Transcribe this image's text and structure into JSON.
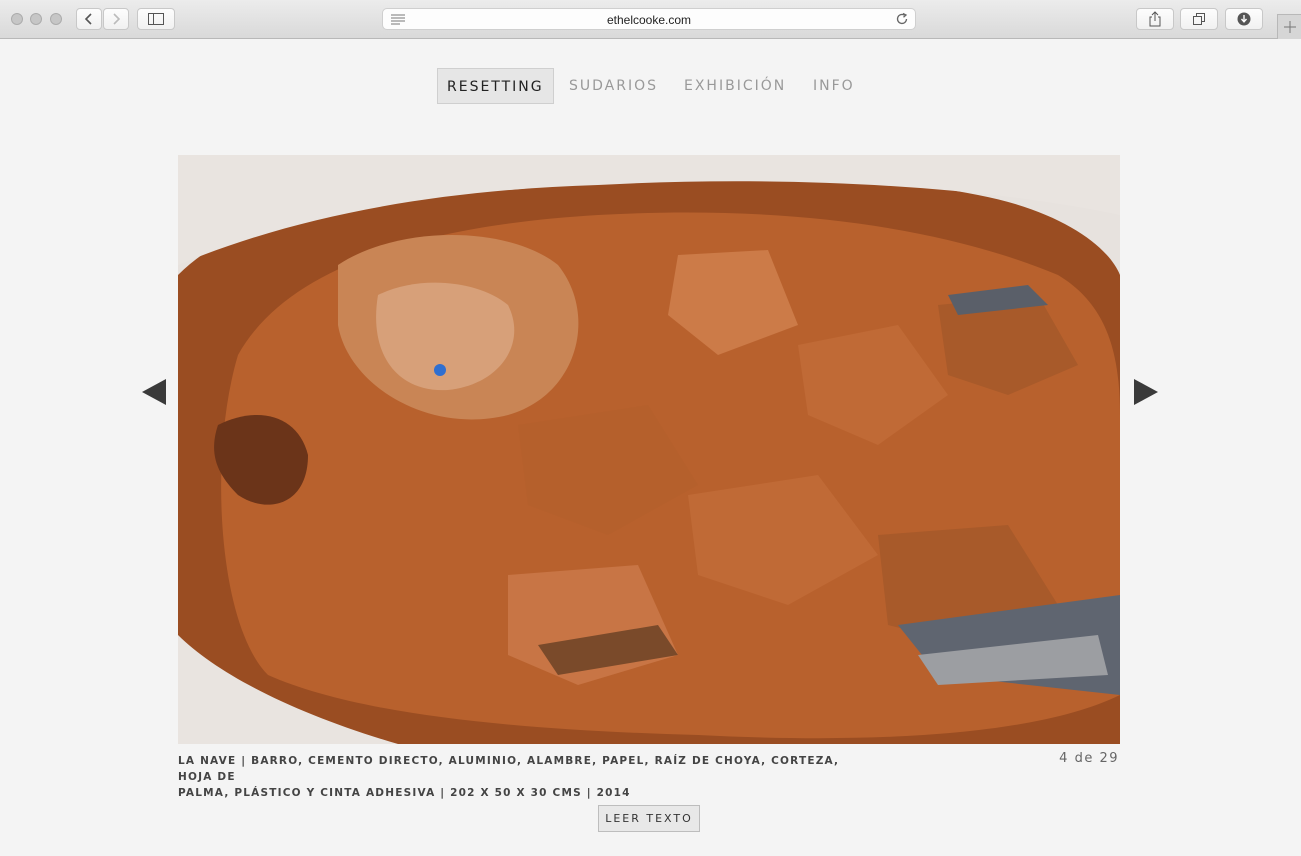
{
  "browser": {
    "url": "ethelcooke.com"
  },
  "nav": {
    "items": [
      {
        "label": "RESETTING",
        "active": true
      },
      {
        "label": "SUDARIOS",
        "active": false
      },
      {
        "label": "EXHIBICIÓN",
        "active": false
      },
      {
        "label": "INFO",
        "active": false
      }
    ]
  },
  "artwork": {
    "caption_line1": "LA NAVE | BARRO, CEMENTO DIRECTO, ALUMINIO, ALAMBRE, PAPEL, RAÍZ DE CHOYA, CORTEZA, HOJA DE",
    "caption_line2": "PALMA, PLÁSTICO Y CINTA ADHESIVA | 202 X 50 X 30 CMS | 2014",
    "counter": "4 de 29",
    "read_button": "LEER TEXTO"
  },
  "colors": {
    "clay": "#b5602c",
    "clay_light": "#d0885a",
    "clay_dark": "#6b3419",
    "background": "#f4f4f4"
  }
}
